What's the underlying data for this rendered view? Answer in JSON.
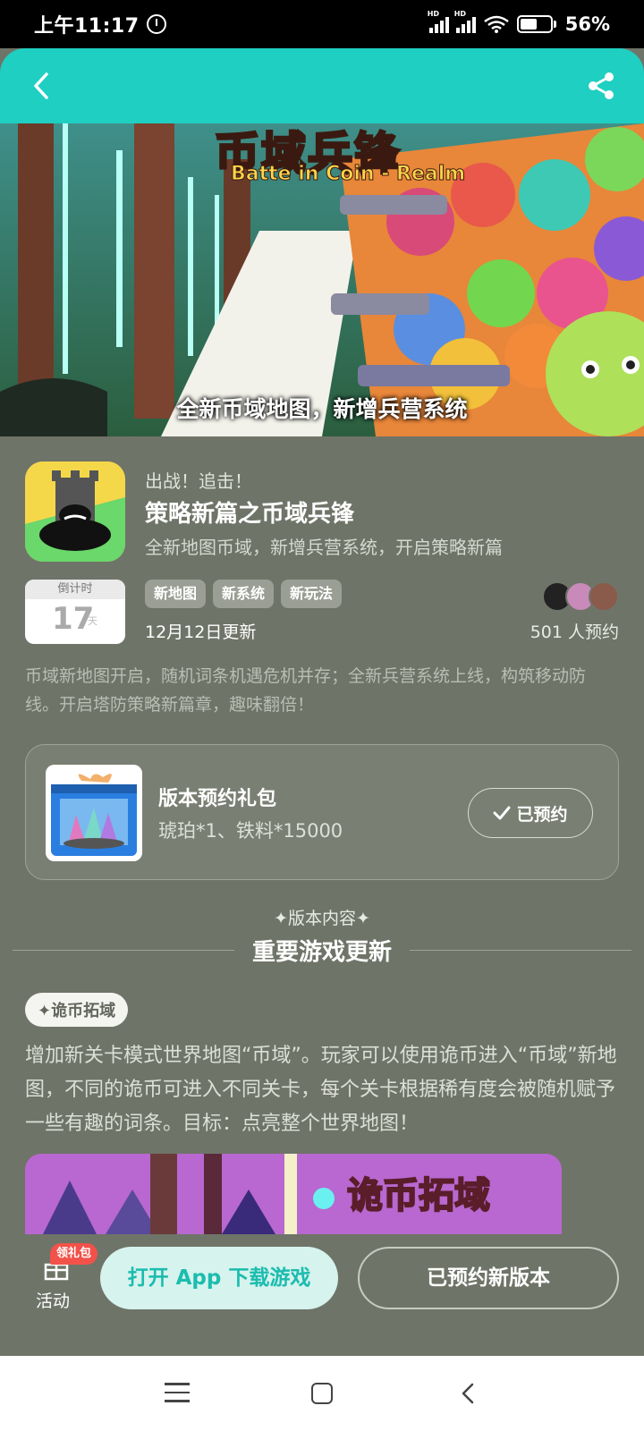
{
  "status_bar": {
    "time": "上午11:17",
    "battery": "56%",
    "network_badge": "HD"
  },
  "header": {
    "back_icon": "chevron-left-icon",
    "share_icon": "share-icon",
    "color": "#1fcfc2"
  },
  "banner": {
    "logo_text": "币域兵锋",
    "logo_subtitle": "Batte in Coin - Realm",
    "caption": "全新币域地图，新增兵营系统"
  },
  "game": {
    "tagline": "出战！追击！",
    "title": "策略新篇之币域兵锋",
    "description": "全新地图币域，新增兵营系统，开启策略新篇"
  },
  "countdown": {
    "label": "倒计时",
    "value": "17",
    "unit": "天"
  },
  "tags": [
    "新地图",
    "新系统",
    "新玩法"
  ],
  "update_date": "12月12日更新",
  "reserve_count": "501 人预约",
  "intro": "币域新地图开启，随机词条机遇危机并存；全新兵营系统上线，构筑移动防线。开启塔防策略新篇章，趣味翻倍！",
  "gift": {
    "title": "版本预约礼包",
    "description": "琥珀*1、铁料*15000",
    "button_label": "已预约",
    "button_icon": "check-icon"
  },
  "section": {
    "subtitle": "✦版本内容✦",
    "title": "重要游戏更新"
  },
  "feature": {
    "chip_label": "✦诡币拓域",
    "text": "增加新关卡模式世界地图“币域”。玩家可以使用诡币进入“币域”新地图，不同的诡币可进入不同关卡，每个关卡根据稀有度会被随机赋予一些有趣的词条。目标：点亮整个世界地图！",
    "image_text": "诡币拓域"
  },
  "bottom": {
    "gift_badge": "领礼包",
    "activity_label": "活动",
    "open_app_label": "打开 App 下载游戏",
    "reserved_label": "已预约新版本"
  }
}
